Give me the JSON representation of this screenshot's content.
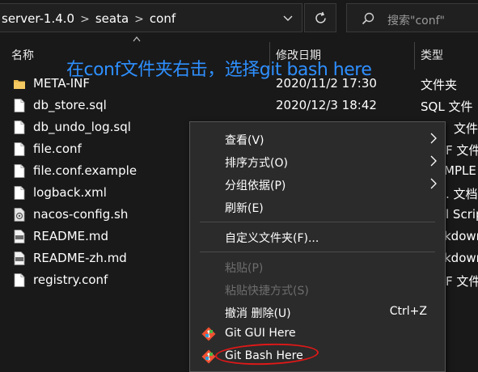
{
  "address_bar": {
    "breadcrumbs": [
      "server-1.4.0",
      "seata",
      "conf"
    ],
    "separator": ">",
    "dropdown_icon": "chevron-down-icon",
    "refresh_icon": "refresh-icon"
  },
  "search": {
    "placeholder": "搜索\"conf\"",
    "icon": "search-icon"
  },
  "columns": {
    "name": "名称",
    "date": "修改日期",
    "type": "类型"
  },
  "annotation": {
    "text": "在conf文件夹右击，选择git bash here",
    "color": "#2e8fff"
  },
  "files": [
    {
      "name": "META-INF",
      "date": "2020/11/2 17:30",
      "type": "文件夹",
      "icon": "folder-icon"
    },
    {
      "name": "db_store.sql",
      "date": "2020/12/3 18:42",
      "type": "SQL 文件",
      "icon": "file-icon"
    },
    {
      "name": "db_undo_log.sql",
      "date": "",
      "type": "文件",
      "icon": "file-icon"
    },
    {
      "name": "file.conf",
      "date": "",
      "type": "F 文件",
      "icon": "file-icon"
    },
    {
      "name": "file.conf.example",
      "date": "",
      "type": "MPLE",
      "icon": "file-icon"
    },
    {
      "name": "logback.xml",
      "date": "",
      "type": ". 文档",
      "icon": "file-icon"
    },
    {
      "name": "nacos-config.sh",
      "date": "",
      "type": "l Scrip",
      "icon": "script-icon"
    },
    {
      "name": "README.md",
      "date": "",
      "type": "kdown",
      "icon": "markdown-icon"
    },
    {
      "name": "README-zh.md",
      "date": "",
      "type": "kdown",
      "icon": "markdown-icon"
    },
    {
      "name": "registry.conf",
      "date": "",
      "type": "F 文件",
      "icon": "file-icon"
    }
  ],
  "context_menu": {
    "items": [
      {
        "label": "查看(V)",
        "submenu": true,
        "disabled": false
      },
      {
        "label": "排序方式(O)",
        "submenu": true,
        "disabled": false
      },
      {
        "label": "分组依据(P)",
        "submenu": true,
        "disabled": false
      },
      {
        "label": "刷新(E)",
        "submenu": false,
        "disabled": false
      },
      {
        "label": "自定义文件夹(F)...",
        "submenu": false,
        "disabled": false
      },
      {
        "label": "粘贴(P)",
        "submenu": false,
        "disabled": true
      },
      {
        "label": "粘贴快捷方式(S)",
        "submenu": false,
        "disabled": true
      },
      {
        "label": "撤消 删除(U)",
        "shortcut": "Ctrl+Z",
        "submenu": false,
        "disabled": false
      },
      {
        "label": "Git GUI Here",
        "icon": "git-icon",
        "submenu": false,
        "disabled": false
      },
      {
        "label": "Git Bash Here",
        "icon": "git-icon",
        "submenu": false,
        "disabled": false,
        "highlighted_by": "red-ellipse"
      }
    ]
  },
  "colors": {
    "background": "#191919",
    "menu_background": "#2b2b2b",
    "folder": "#e8b84a",
    "highlight_ellipse": "#e01818"
  }
}
